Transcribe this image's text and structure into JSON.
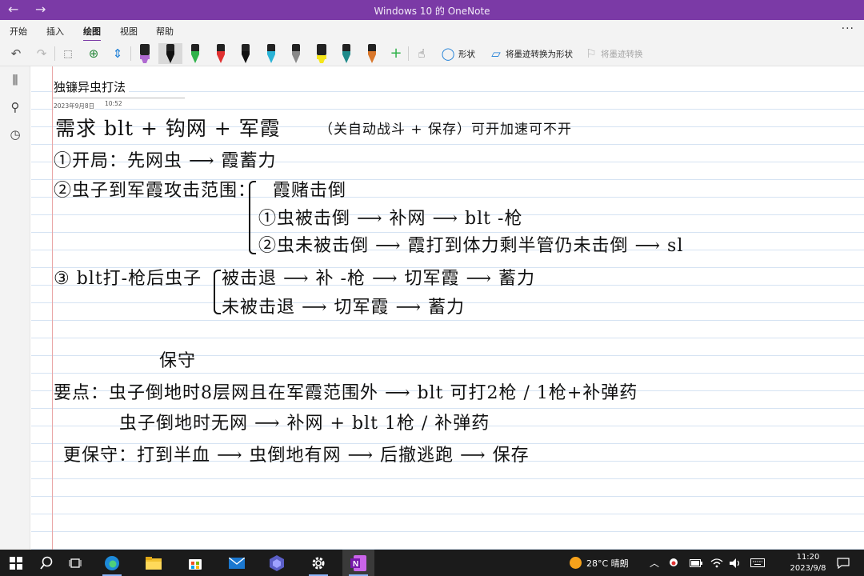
{
  "app": {
    "window_title": "Windows 10 的 OneNote",
    "back_glyph": "←",
    "forward_glyph": "→"
  },
  "menu": {
    "tabs": [
      {
        "label": "开始"
      },
      {
        "label": "插入"
      },
      {
        "label": "绘图",
        "active": true
      },
      {
        "label": "视图"
      },
      {
        "label": "帮助"
      }
    ],
    "more_glyph": "···"
  },
  "toolbar": {
    "shapes_label": "形状",
    "ink_to_shape_label": "将墨迹转换为形状",
    "ink_to_text_label": "将墨迹转换",
    "pens": [
      {
        "icon": "highlighter-pen-icon",
        "color": "#b06ad1"
      },
      {
        "icon": "pen-black-selected-icon",
        "color": "#111111"
      },
      {
        "icon": "pen-green-icon",
        "color": "#2fb24a"
      },
      {
        "icon": "pen-red-icon",
        "color": "#e03131"
      },
      {
        "icon": "pen-black-icon",
        "color": "#111111"
      },
      {
        "icon": "pen-cyan-icon",
        "color": "#2ab3d6"
      },
      {
        "icon": "pen-gray-icon",
        "color": "#888888"
      },
      {
        "icon": "highlighter-yellow-icon",
        "color": "#f5e61a"
      },
      {
        "icon": "pen-teal-icon",
        "color": "#1f8a8a"
      },
      {
        "icon": "pen-galaxy-icon",
        "color": "#d9772b"
      }
    ]
  },
  "page": {
    "title": "独镰异虫打法",
    "date": "2023年9月8日",
    "time": "10:52",
    "ink_lines": [
      "需求 blt + 钩网 + 军霞",
      "（关自动战斗 + 保存）可开加速可不开",
      "①开局：先网虫 ⟶ 霞蓄力",
      "②虫子到军霞攻击范围：",
      "霞赌击倒",
      "①虫被击倒 ⟶ 补网 ⟶ blt -枪",
      "②虫未被击倒 ⟶ 霞打到体力剩半管仍未击倒 ⟶ sl",
      "③ blt打-枪后虫子",
      "被击退 ⟶ 补 -枪 ⟶ 切军霞 ⟶ 蓄力",
      "未被击退 ⟶ 切军霞 ⟶ 蓄力",
      "保守",
      "要点：虫子倒地时8层网且在军霞范围外 ⟶ blt 可打2枪 / 1枪+补弹药",
      "虫子倒地时无网 ⟶ 补网 + blt 1枪 / 补弹药",
      "更保守：打到半血 ⟶ 虫倒地有网 ⟶ 后撤逃跑 ⟶ 保存"
    ]
  },
  "taskbar": {
    "weather": "28°C 晴朗",
    "time": "11:20",
    "date": "2023/9/8"
  }
}
